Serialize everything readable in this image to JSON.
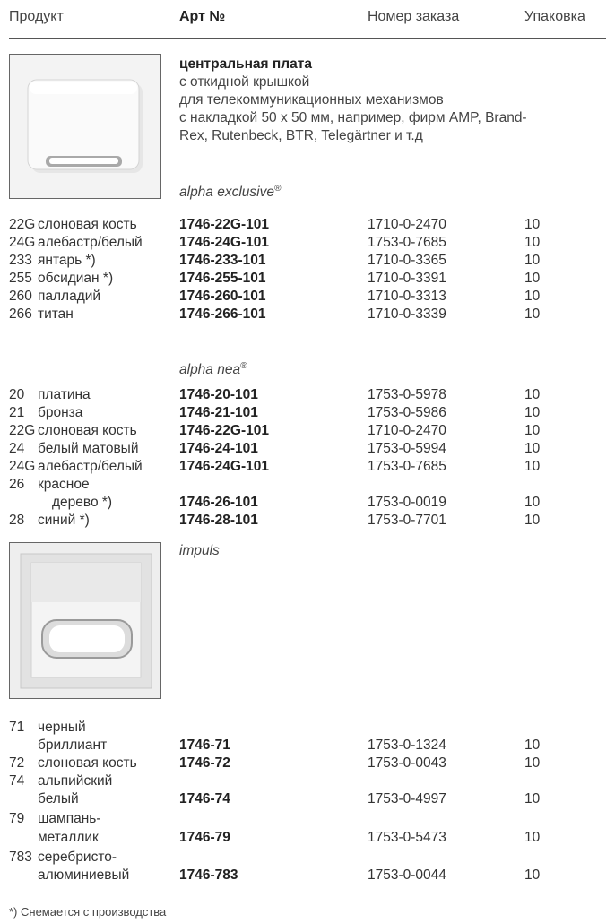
{
  "header": {
    "product": "Продукт",
    "article": "Арт №",
    "order": "Номер заказа",
    "pack": "Упаковка"
  },
  "product": {
    "title": "центральная плата",
    "lines": [
      "с откидной крышкой",
      "для телекоммуникационных механизмов",
      "с накладкой 50 x 50 мм, например, фирм AMP, Brand-",
      "Rex, Rutenbeck, BTR, Telegärtner и т.д"
    ]
  },
  "series_exclusive": {
    "name": "alpha exclusive",
    "reg": "®",
    "rows": [
      {
        "code": "22G",
        "name": "слоновая кость",
        "article": "1746-22G-101",
        "order": "1710-0-2470",
        "pack": "10"
      },
      {
        "code": "24G",
        "name": "алебастр/белый",
        "article": "1746-24G-101",
        "order": "1753-0-7685",
        "pack": "10"
      },
      {
        "code": "233",
        "name": "янтарь *)",
        "article": "1746-233-101",
        "order": "1710-0-3365",
        "pack": "10"
      },
      {
        "code": "255",
        "name": "обсидиан *)",
        "article": "1746-255-101",
        "order": "1710-0-3391",
        "pack": "10"
      },
      {
        "code": "260",
        "name": "палладий",
        "article": "1746-260-101",
        "order": "1710-0-3313",
        "pack": "10"
      },
      {
        "code": "266",
        "name": "титан",
        "article": "1746-266-101",
        "order": "1710-0-3339",
        "pack": "10"
      }
    ]
  },
  "series_nea": {
    "name": "alpha nea",
    "reg": "®",
    "rows": [
      {
        "code": "20",
        "name": "платина",
        "article": "1746-20-101",
        "order": "1753-0-5978",
        "pack": "10"
      },
      {
        "code": "21",
        "name": "бронза",
        "article": "1746-21-101",
        "order": "1753-0-5986",
        "pack": "10"
      },
      {
        "code": "22G",
        "name": "слоновая кость",
        "article": "1746-22G-101",
        "order": "1710-0-2470",
        "pack": "10"
      },
      {
        "code": "24",
        "name": "белый матовый",
        "article": "1746-24-101",
        "order": "1753-0-5994",
        "pack": "10"
      },
      {
        "code": "24G",
        "name": "алебастр/белый",
        "article": "1746-24G-101",
        "order": "1753-0-7685",
        "pack": "10"
      },
      {
        "code": "26",
        "name": "красное",
        "name2": "дерево *)",
        "article": "1746-26-101",
        "order": "1753-0-0019",
        "pack": "10"
      },
      {
        "code": "28",
        "name": "синий *)",
        "article": "1746-28-101",
        "order": "1753-0-7701",
        "pack": "10"
      }
    ]
  },
  "series_impuls": {
    "name": "impuls",
    "rows": [
      {
        "code": "71",
        "name": "черный",
        "name2": "бриллиант",
        "article": "1746-71",
        "order": "1753-0-1324",
        "pack": "10"
      },
      {
        "code": "72",
        "name": "слоновая кость",
        "article": "1746-72",
        "order": "1753-0-0043",
        "pack": "10"
      },
      {
        "code": "74",
        "name": "альпийский",
        "name2": "белый",
        "article": "1746-74",
        "order": "1753-0-4997",
        "pack": "10"
      },
      {
        "code": "79",
        "name": "шампань-",
        "name2": "металлик",
        "article": "1746-79",
        "order": "1753-0-5473",
        "pack": "10"
      },
      {
        "code": "783",
        "name": "серебристо-",
        "name2": "алюминиевый",
        "article": "1746-783",
        "order": "1753-0-0044",
        "pack": "10"
      }
    ]
  },
  "footnote": "*) Снемается с производства"
}
